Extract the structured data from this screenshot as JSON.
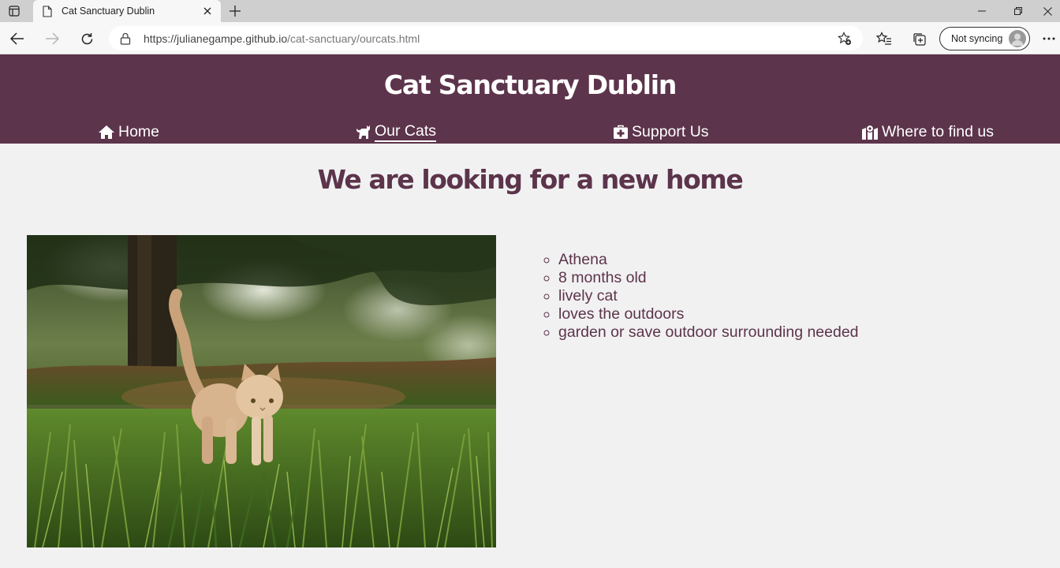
{
  "browser": {
    "tab_title": "Cat Sanctuary Dublin",
    "url_host": "https://julianegampe.github.io",
    "url_path": "/cat-sanctuary/ourcats.html",
    "sync_label": "Not syncing"
  },
  "site": {
    "title": "Cat Sanctuary Dublin",
    "nav": [
      {
        "label": "Home",
        "icon": "home-icon"
      },
      {
        "label": "Our Cats",
        "icon": "cat-icon",
        "active": true
      },
      {
        "label": "Support Us",
        "icon": "first-aid-icon"
      },
      {
        "label": "Where to find us",
        "icon": "map-marker-icon"
      }
    ]
  },
  "main": {
    "headline": "We are looking for a new home",
    "cat": {
      "facts": [
        "Athena",
        "8 months old",
        "lively cat",
        "loves the outdoors",
        "garden or save outdoor surrounding needed"
      ]
    }
  },
  "colors": {
    "brand": "#5c344b",
    "page_bg": "#f1f1f1"
  }
}
